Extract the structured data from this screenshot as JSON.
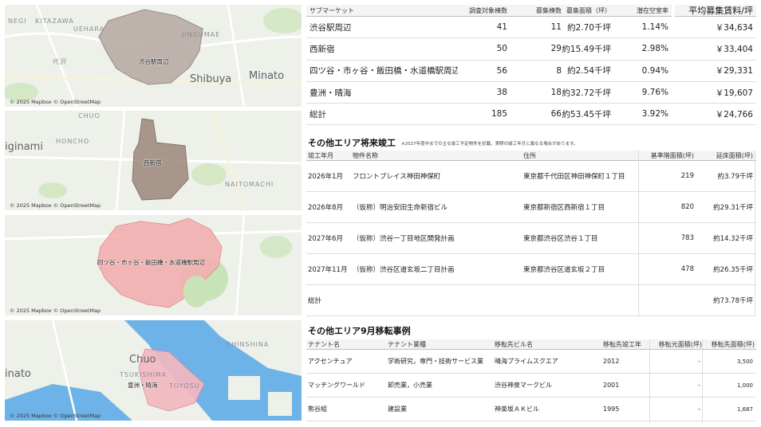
{
  "maps": [
    {
      "name": "shibuya",
      "area_label": "渋谷駅周辺",
      "place_labels": [
        "NEGI",
        "KITAZAWA",
        "UEHARA",
        "JINGUMAE",
        "代沢"
      ],
      "big_labels": [
        "Shibuya",
        "Minato"
      ],
      "credit": "© 2025 Mapbox © OpenStreetMap",
      "fill_color": "#b8aca6"
    },
    {
      "name": "nishishinjuku",
      "area_label": "西新宿",
      "place_labels": [
        "CHUO",
        "HONCHO",
        "NAITOMACHI"
      ],
      "big_labels": [
        "iginami"
      ],
      "credit": "© 2025 Mapbox © OpenStreetMap",
      "fill_color": "#a48f84"
    },
    {
      "name": "yotsuya",
      "area_label": "四ツ谷・市ヶ谷・飯田橋・水道橋駅周辺",
      "place_labels": [],
      "big_labels": [],
      "credit": "© 2025 Mapbox © OpenStreetMap",
      "fill_color": "#f3b1b1"
    },
    {
      "name": "toyosu",
      "area_label": "豊洲・晴海",
      "place_labels": [
        "SHINSHINA",
        "TSUKISHIMA",
        "TOYOSU"
      ],
      "big_labels": [
        "Chuo",
        "inato"
      ],
      "credit": "© 2025 Mapbox © OpenStreetMap",
      "fill_color": "#f3b8c0"
    }
  ],
  "market": {
    "headers": [
      "サブマーケット",
      "調査対象棟数",
      "募集棟数",
      "募集面積（坪）",
      "潜在空室率",
      "平均募集賃料/坪"
    ],
    "rows": [
      [
        "渋谷駅周辺",
        "41",
        "11",
        "約2.70千坪",
        "1.14%",
        "￥34,634"
      ],
      [
        "西新宿",
        "50",
        "29",
        "約15.49千坪",
        "2.98%",
        "￥33,404"
      ],
      [
        "四ツ谷・市ヶ谷・飯田橋・水道橋駅周辺",
        "56",
        "8",
        "約2.54千坪",
        "0.94%",
        "￥29,331"
      ],
      [
        "豊洲・晴海",
        "38",
        "18",
        "約32.72千坪",
        "9.76%",
        "￥19,607"
      ],
      [
        "総計",
        "185",
        "66",
        "約53.45千坪",
        "3.92%",
        "￥24,766"
      ]
    ]
  },
  "future": {
    "title": "その他エリア将来竣工",
    "note": "※2027年度中までの主な竣工予定物件を記載。実際の竣工年月と異なる場合があります。",
    "headers": [
      "竣工年月",
      "物件名称",
      "住所",
      "基準階面積(坪)",
      "延床面積(坪)"
    ],
    "rows": [
      [
        "2026年1月",
        "フロントプレイス神田神保町",
        "東京都千代田区神田神保町１丁目",
        "219",
        "約3.79千坪"
      ],
      [
        "2026年8月",
        "（仮称）明治安田生命新宿ビル",
        "東京都新宿区西新宿１丁目",
        "820",
        "約29.31千坪"
      ],
      [
        "2027年6月",
        "（仮称）渋谷一丁目地区開発計画",
        "東京都渋谷区渋谷１丁目",
        "783",
        "約14.32千坪"
      ],
      [
        "2027年11月",
        "（仮称）渋谷区道玄坂二丁目計画",
        "東京都渋谷区道玄坂２丁目",
        "478",
        "約26.35千坪"
      ]
    ],
    "total": [
      "総計",
      "",
      "",
      "",
      "約73.78千坪"
    ]
  },
  "relocation": {
    "title": "その他エリア9月移転事例",
    "headers": [
      "テナント名",
      "テナント業種",
      "移転先ビル名",
      "移転先竣工年",
      "移転元面積(坪)",
      "移転先面積(坪)"
    ],
    "rows": [
      [
        "アクセンチュア",
        "学術研究，専門・技術サービス業",
        "晴海プライムスクエア",
        "2012",
        "-",
        "3,500"
      ],
      [
        "マッチングワールド",
        "卸売業，小売業",
        "渋谷神泉マークビル",
        "2001",
        "-",
        "1,000"
      ],
      [
        "熊谷組",
        "建設業",
        "神楽坂ＡＫビル",
        "1995",
        "-",
        "1,687"
      ]
    ]
  }
}
